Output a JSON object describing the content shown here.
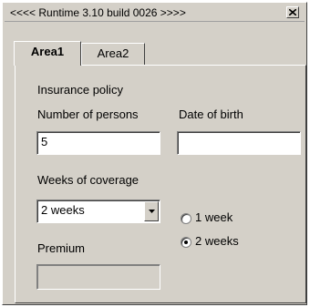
{
  "window": {
    "title": "<<<< Runtime 3.10 build 0026 >>>>"
  },
  "tabs": [
    {
      "label": "Area1",
      "active": true
    },
    {
      "label": "Area2",
      "active": false
    }
  ],
  "form": {
    "section_title": "Insurance policy",
    "persons_label": "Number of persons",
    "persons_value": "5",
    "dob_label": "Date of birth",
    "dob_value": "",
    "weeks_label": "Weeks of coverage",
    "weeks_selected": "2 weeks",
    "radio_options": [
      {
        "label": "1 week",
        "checked": false
      },
      {
        "label": "2 weeks",
        "checked": true
      }
    ],
    "premium_label": "Premium",
    "premium_value": ""
  },
  "icons": {
    "close": "close-icon",
    "dropdown": "chevron-down-icon"
  }
}
